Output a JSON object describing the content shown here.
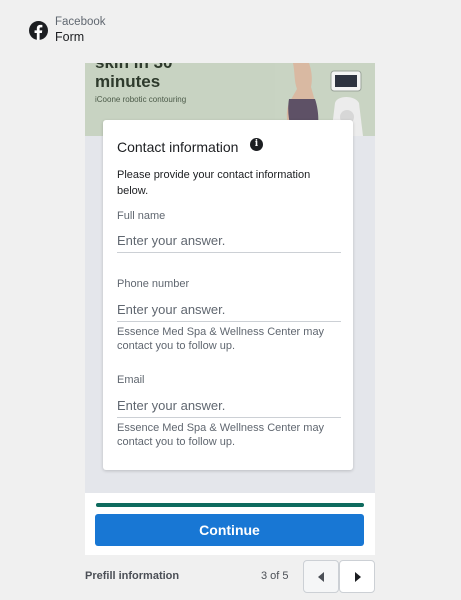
{
  "header": {
    "label": "Facebook",
    "title": "Form",
    "logo_icon": "facebook-logo-icon"
  },
  "banner": {
    "headline": "skin in 30 minutes",
    "subtext": "iCoone robotic contouring"
  },
  "card": {
    "title": "Contact information",
    "info_icon": "info-icon",
    "description": "Please provide your contact information below.",
    "fields": [
      {
        "label": "Full name",
        "placeholder": "Enter your answer.",
        "value": "",
        "note": ""
      },
      {
        "label": "Phone number",
        "placeholder": "Enter your answer.",
        "value": "",
        "note": "Essence Med Spa & Wellness Center may contact you to follow up."
      },
      {
        "label": "Email",
        "placeholder": "Enter your answer.",
        "value": "",
        "note": "Essence Med Spa & Wellness Center may contact you to follow up."
      }
    ]
  },
  "footer": {
    "progress_fraction": 1.0,
    "continue_label": "Continue"
  },
  "bottom": {
    "prefill_label": "Prefill information",
    "page_count": "3 of 5",
    "prev_icon": "chevron-left-icon",
    "next_icon": "chevron-right-icon"
  },
  "colors": {
    "accent": "#1877d4",
    "progress": "#0e6b5e",
    "facebook_logo": "#1c1e21"
  }
}
